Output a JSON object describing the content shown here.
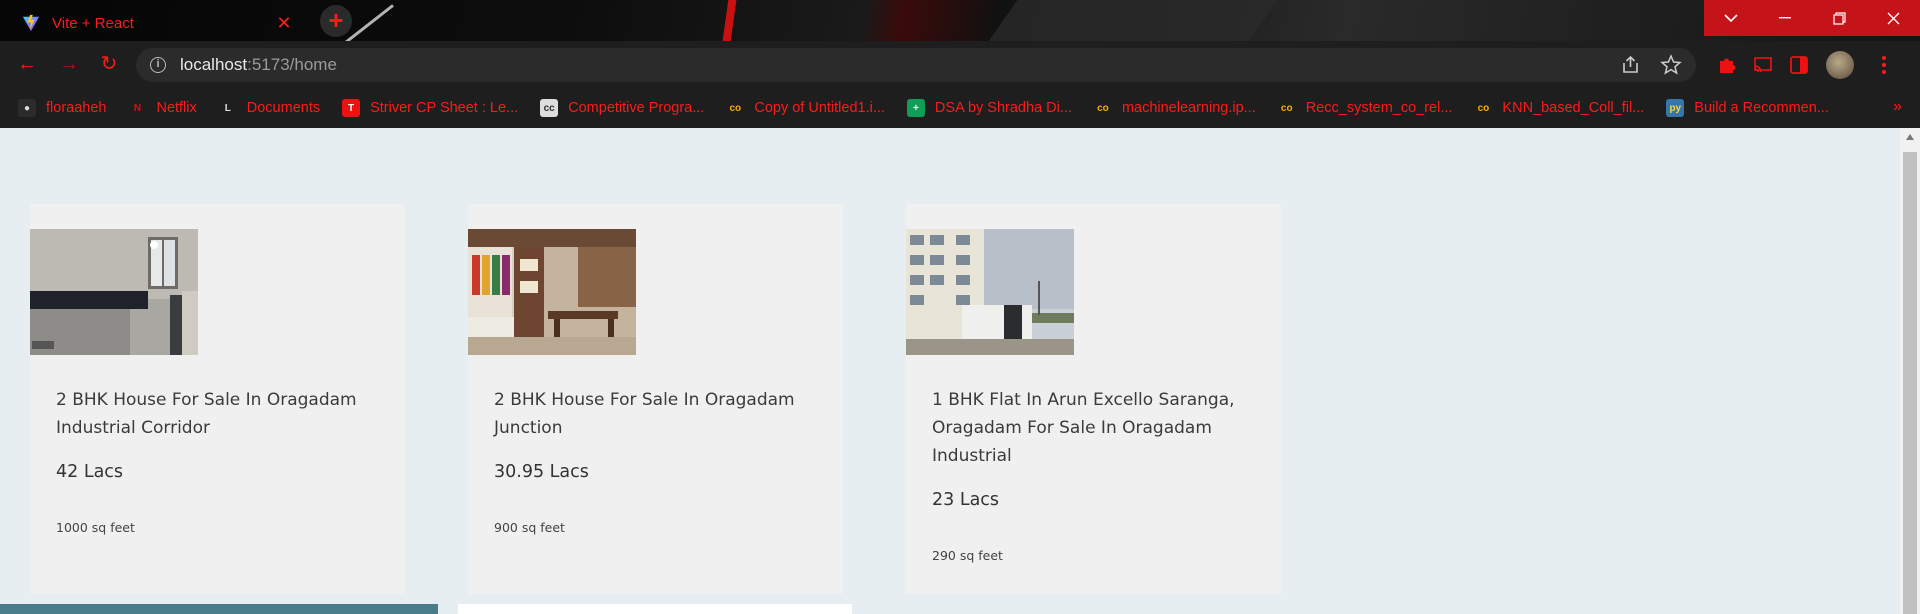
{
  "browser": {
    "tab": {
      "title": "Vite + React",
      "favicon": "vite-logo-icon",
      "close_glyph": "✕"
    },
    "new_tab_glyph": "+",
    "window_controls": [
      "chevron-down-icon",
      "minimize-icon",
      "restore-icon",
      "close-icon"
    ],
    "nav": {
      "back": "←",
      "forward": "→",
      "reload": "↻"
    },
    "address": {
      "host": "localhost",
      "path": ":5173/home",
      "info_glyph": "i"
    },
    "omnibox_icons": [
      "share-icon",
      "star-icon"
    ],
    "extensions": [
      "puzzle-extension-icon",
      "cast-icon",
      "sidebar-icon"
    ],
    "accent_color": "#ff1a1a"
  },
  "bookmarks": [
    {
      "label": "floraaheh",
      "icon": "github-icon",
      "icon_bg": "#2b2b2b",
      "icon_fg": "#ddd",
      "glyph": "●"
    },
    {
      "label": "Netflix",
      "icon": "netflix-icon",
      "icon_bg": "#1e1e1e",
      "icon_fg": "#e50914",
      "glyph": "N"
    },
    {
      "label": "Documents",
      "icon": "docs-icon",
      "icon_bg": "#1e1e1e",
      "icon_fg": "#ddd",
      "glyph": "L"
    },
    {
      "label": "Striver CP Sheet : Le...",
      "icon": "tuf-icon",
      "icon_bg": "#e11",
      "icon_fg": "#fff",
      "glyph": "T"
    },
    {
      "label": "Competitive Progra...",
      "icon": "cc-icon",
      "icon_bg": "#ddd",
      "icon_fg": "#333",
      "glyph": "cc"
    },
    {
      "label": "Copy of Untitled1.i...",
      "icon": "colab-icon",
      "icon_bg": "#1e1e1e",
      "icon_fg": "#f9ab00",
      "glyph": "co"
    },
    {
      "label": "DSA by Shradha Di...",
      "icon": "sheets-icon",
      "icon_bg": "#0f9d58",
      "icon_fg": "#fff",
      "glyph": "+"
    },
    {
      "label": "machinelearning.ip...",
      "icon": "colab-icon",
      "icon_bg": "#1e1e1e",
      "icon_fg": "#f9ab00",
      "glyph": "co"
    },
    {
      "label": "Recc_system_co_rel...",
      "icon": "colab-icon",
      "icon_bg": "#1e1e1e",
      "icon_fg": "#f9ab00",
      "glyph": "co"
    },
    {
      "label": "KNN_based_Coll_fil...",
      "icon": "colab-icon",
      "icon_bg": "#1e1e1e",
      "icon_fg": "#f9ab00",
      "glyph": "co"
    },
    {
      "label": "Build a Recommen...",
      "icon": "python-icon",
      "icon_bg": "#3776ab",
      "icon_fg": "#ffd43b",
      "glyph": "py"
    }
  ],
  "bookmarks_more": "»",
  "listings": [
    {
      "title": "2 BHK House For Sale In Oragadam Industrial Corridor",
      "price": "42 Lacs",
      "area": "1000 sq feet",
      "image": "kitchen-interior-photo"
    },
    {
      "title": "2 BHK House For Sale In Oragadam Junction",
      "price": "30.95 Lacs",
      "area": "900 sq feet",
      "image": "dining-interior-photo"
    },
    {
      "title": "1 BHK Flat In Arun Excello Saranga, Oragadam For Sale In Oragadam Industrial",
      "price": "23 Lacs",
      "area": "290 sq feet",
      "image": "apartment-exterior-photo"
    }
  ]
}
